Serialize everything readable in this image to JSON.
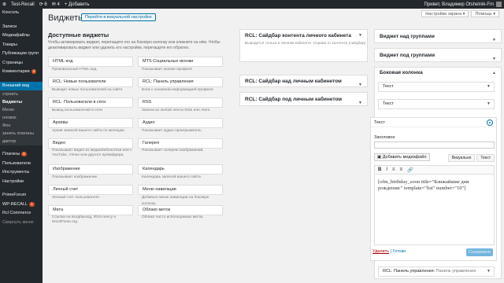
{
  "adminbar": {
    "site_name": "Test-Recall",
    "updates": "6",
    "comments": "4",
    "add_new": "+ Добавить",
    "greeting": "Привет, Владимир Otshelnik-Fm"
  },
  "sidebar": {
    "items": [
      {
        "label": "Консоль"
      },
      {
        "label": "Записи"
      },
      {
        "label": "Медиафайлы"
      },
      {
        "label": "Товары"
      },
      {
        "label": "Публикации групп"
      },
      {
        "label": "Страницы"
      },
      {
        "label": "Комментарии",
        "badge": "4"
      },
      {
        "label": "Внешний вид"
      },
      {
        "label": "строить"
      },
      {
        "label": "Виджеты"
      },
      {
        "label": "Меню"
      },
      {
        "label": "оловок"
      },
      {
        "label": "Фон"
      },
      {
        "label": "занить плагины"
      },
      {
        "label": "дактор"
      },
      {
        "label": "Плагины",
        "badge": "6"
      },
      {
        "label": "Пользователи"
      },
      {
        "label": "Инструменты"
      },
      {
        "label": "Настройки"
      },
      {
        "label": "PrimeForum"
      },
      {
        "label": "WP-RECALL",
        "badge": "1"
      },
      {
        "label": "Rcl Commerce"
      },
      {
        "label": "Свернуть меню"
      }
    ]
  },
  "header": {
    "screen_options": "Настройки экрана ▾",
    "help": "Помощь ▾",
    "title": "Виджеты",
    "visual_button": "Перейти в визуальной настройке"
  },
  "available": {
    "heading": "Доступные виджеты",
    "description": "Чтобы активировать виджет, перетащите его на боковую колонку или кликните на нём. Чтобы деактивировать виджет или удалить его настройки, перетащите его обратно.",
    "widgets": [
      {
        "name": "HTML-код",
        "desc": "Произвольный HTML-код."
      },
      {
        "name": "MTS Социальные иконки",
        "desc": "Показывает иконки профиля"
      },
      {
        "name": "RCL: Новые пользователи",
        "desc": "Выводит новых пользователей на сайте"
      },
      {
        "name": "RCL: Панель управления",
        "desc": "Блок с основной информацией профиля"
      },
      {
        "name": "RCL: Пользователи в сети",
        "desc": "Вывод пользователей в сети"
      },
      {
        "name": "RSS",
        "desc": "Записи из любой ленты RSS или Atom."
      },
      {
        "name": "Архивы",
        "desc": "Архив записей вашего сайта по месяцам."
      },
      {
        "name": "Аудио",
        "desc": "Показывает аудио проигрыватель."
      },
      {
        "name": "Видео",
        "desc": "Показывает видео из медиабиблиотеки или с YouTube, Vimeo или другого провайдера."
      },
      {
        "name": "Галерея",
        "desc": "Показывает галерею изображений."
      },
      {
        "name": "Изображение",
        "desc": "Показывает изображение."
      },
      {
        "name": "Календарь",
        "desc": "Календарь записей вашего сайта."
      },
      {
        "name": "Личный счет",
        "desc": "Личный счет пользователя"
      },
      {
        "name": "Меню навигации",
        "desc": "Добавьте меню навигации на боковую колонку."
      },
      {
        "name": "Мета",
        "desc": "Ссылки на вход/выход, RSS-ленту и WordPress.org."
      },
      {
        "name": "Облако меток",
        "desc": "Облако часто используемых меток."
      }
    ]
  },
  "areas": {
    "content": {
      "title": "RCL: Сайдбар контента личного кабинета",
      "desc": "Выводится только в личном кабинете. Справа от контента (сайдбар)"
    },
    "above": {
      "title": "RCL: Сайдбар над личным кабинетом"
    },
    "below": {
      "title": "RCL: Сайдбар под личным кабинетом"
    },
    "above_groups": {
      "title": "Виджет над группами"
    },
    "below_groups": {
      "title": "Виджет под группами"
    },
    "sidebar": {
      "title": "Боковая колонка",
      "widgets": [
        "Текст",
        "Текст"
      ]
    }
  },
  "editor": {
    "header": "Текст",
    "label": "Заголовок:",
    "title_value": "",
    "media_button": "Добавить медиафайл",
    "tab_visual": "Визуально",
    "tab_text": "Текст",
    "toolbar": [
      "B",
      "I",
      "≡",
      "≡",
      "🔗"
    ],
    "content": "[ofm_birthday_soon title=\"Ближайшие дни рождения:\" template=\"list\" number=\"10\"]",
    "delete": "Удалить",
    "separator": " | ",
    "done": "Готово",
    "save": "Сохранено"
  },
  "bottom_widget": {
    "label": "RCL: Панель управления:",
    "sub": "Панель управления"
  }
}
